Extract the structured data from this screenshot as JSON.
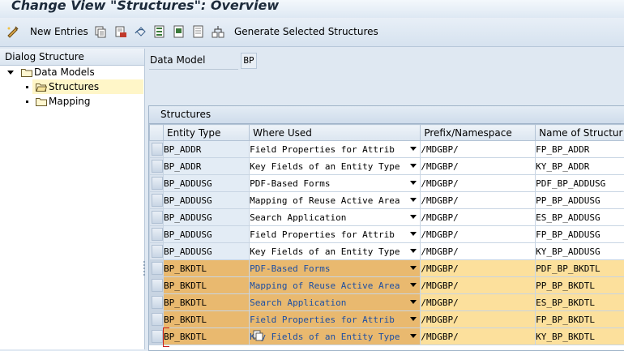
{
  "window": {
    "title": "Change View \"Structures\": Overview"
  },
  "toolbar": {
    "new_entries_label": "New Entries",
    "generate_label": "Generate Selected Structures",
    "icons": [
      "new-entries-icon",
      "copy-icon",
      "delete-icon",
      "undo-icon",
      "select-all-icon",
      "select-block-icon",
      "deselect-all-icon",
      "configure-icon"
    ]
  },
  "dialog_structure": {
    "header": "Dialog Structure",
    "items": [
      {
        "label": "Data Models",
        "level": 0,
        "expanded": true
      },
      {
        "label": "Structures",
        "level": 1,
        "selected": true
      },
      {
        "label": "Mapping",
        "level": 1
      }
    ]
  },
  "data_model": {
    "label": "Data Model",
    "value": "BP"
  },
  "structures": {
    "title": "Structures",
    "columns": [
      "Entity Type",
      "Where Used",
      "Prefix/Namespace",
      "Name of Structur"
    ],
    "rows": [
      {
        "entity": "BP_ADDR",
        "where_used": "Field Properties for Attrib",
        "prefix": "/MDGBP/",
        "name": "FP_BP_ADDR",
        "highlighted": false
      },
      {
        "entity": "BP_ADDR",
        "where_used": "Key Fields of an Entity Type",
        "prefix": "/MDGBP/",
        "name": "KY_BP_ADDR",
        "highlighted": false
      },
      {
        "entity": "BP_ADDUSG",
        "where_used": "PDF-Based Forms",
        "prefix": "/MDGBP/",
        "name": "PDF_BP_ADDUSG",
        "highlighted": false
      },
      {
        "entity": "BP_ADDUSG",
        "where_used": "Mapping of Reuse Active Area",
        "prefix": "/MDGBP/",
        "name": "PP_BP_ADDUSG",
        "highlighted": false
      },
      {
        "entity": "BP_ADDUSG",
        "where_used": "Search Application",
        "prefix": "/MDGBP/",
        "name": "ES_BP_ADDUSG",
        "highlighted": false
      },
      {
        "entity": "BP_ADDUSG",
        "where_used": "Field Properties for Attrib",
        "prefix": "/MDGBP/",
        "name": "FP_BP_ADDUSG",
        "highlighted": false
      },
      {
        "entity": "BP_ADDUSG",
        "where_used": "Key Fields of an Entity Type",
        "prefix": "/MDGBP/",
        "name": "KY_BP_ADDUSG",
        "highlighted": false
      },
      {
        "entity": "BP_BKDTL",
        "where_used": "PDF-Based Forms",
        "prefix": "/MDGBP/",
        "name": "PDF_BP_BKDTL",
        "highlighted": true
      },
      {
        "entity": "BP_BKDTL",
        "where_used": "Mapping of Reuse Active Area",
        "prefix": "/MDGBP/",
        "name": "PP_BP_BKDTL",
        "highlighted": true
      },
      {
        "entity": "BP_BKDTL",
        "where_used": "Search Application",
        "prefix": "/MDGBP/",
        "name": "ES_BP_BKDTL",
        "highlighted": true
      },
      {
        "entity": "BP_BKDTL",
        "where_used": "Field Properties for Attrib",
        "prefix": "/MDGBP/",
        "name": "FP_BP_BKDTL",
        "highlighted": true
      },
      {
        "entity": "BP_BKDTL",
        "where_used": "Key Fields of an Entity Type",
        "prefix": "/MDGBP/",
        "name": "KY_BP_BKDTL",
        "highlighted": true
      }
    ]
  },
  "colors": {
    "highlight_entity": "#e9b96f",
    "highlight_cells": "#fce09c",
    "link_text": "#1d4fa3"
  }
}
